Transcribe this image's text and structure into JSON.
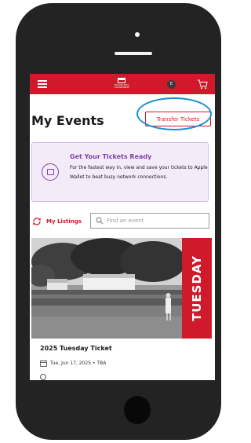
{
  "header": {
    "menu_icon": "hamburger-menu-icon",
    "logo_line1": "TRAVELERS",
    "logo_line2": "CHAMPIONSHIP",
    "avatar_initial": "E",
    "cart_icon": "shopping-cart-icon",
    "brand_color": "#d0192a"
  },
  "page": {
    "title": "My Events",
    "transfer_button": "Transfer Tickets",
    "highlight_color": "#1a8fd3"
  },
  "promo": {
    "icon": "wallet-pass-icon",
    "title": "Get Your Tickets Ready",
    "body": "For the fastest way in, view and save your tickets to Apple Wallet to beat busy network connections.",
    "accent_color": "#7f3eaa"
  },
  "listings": {
    "icon": "refresh-arrows-icon",
    "label": "My Listings",
    "search_placeholder": "Find an event"
  },
  "event": {
    "banner_text": "TUESDAY",
    "title": "2025 Tuesday Ticket",
    "meta": "Tue, Jun 17, 2025 • TBA"
  }
}
